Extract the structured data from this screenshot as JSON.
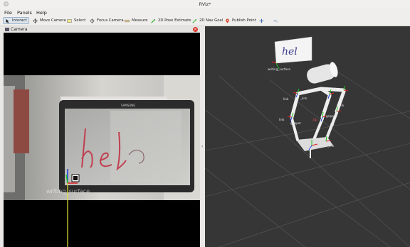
{
  "window": {
    "title": "RViz*"
  },
  "menu": {
    "file": "File",
    "panels": "Panels",
    "help": "Help"
  },
  "toolbar": {
    "interact": "Interact",
    "move_camera": "Move Camera",
    "select": "Select",
    "focus_camera": "Focus Camera",
    "measure": "Measure",
    "pose_estimate": "2D Pose Estimate",
    "nav_goal": "2D Nav Goal",
    "publish_point": "Publish Point"
  },
  "camera_panel": {
    "title": "Camera",
    "overlay_text": "writing_surface",
    "tablet_brand": "SAMSUNG"
  },
  "viewport": {
    "frame_labels": {
      "writing_surface": "writing_surface",
      "link_a": "link",
      "link_b": "_link",
      "link_c": "link",
      "link_d": "link",
      "link_e": "link",
      "gripper_a": "gripper",
      "gripper_b": "gripper",
      "tip_a": "_tip",
      "tip_b": "tip",
      "link_f": "_link"
    },
    "whiteboard_text": "hel"
  },
  "colors": {
    "background": "#363636",
    "grid": "#5a5a5a",
    "robot": "#e9e9e9",
    "axis_x": "#e02020",
    "axis_y": "#20c020",
    "axis_z": "#2040e0"
  }
}
